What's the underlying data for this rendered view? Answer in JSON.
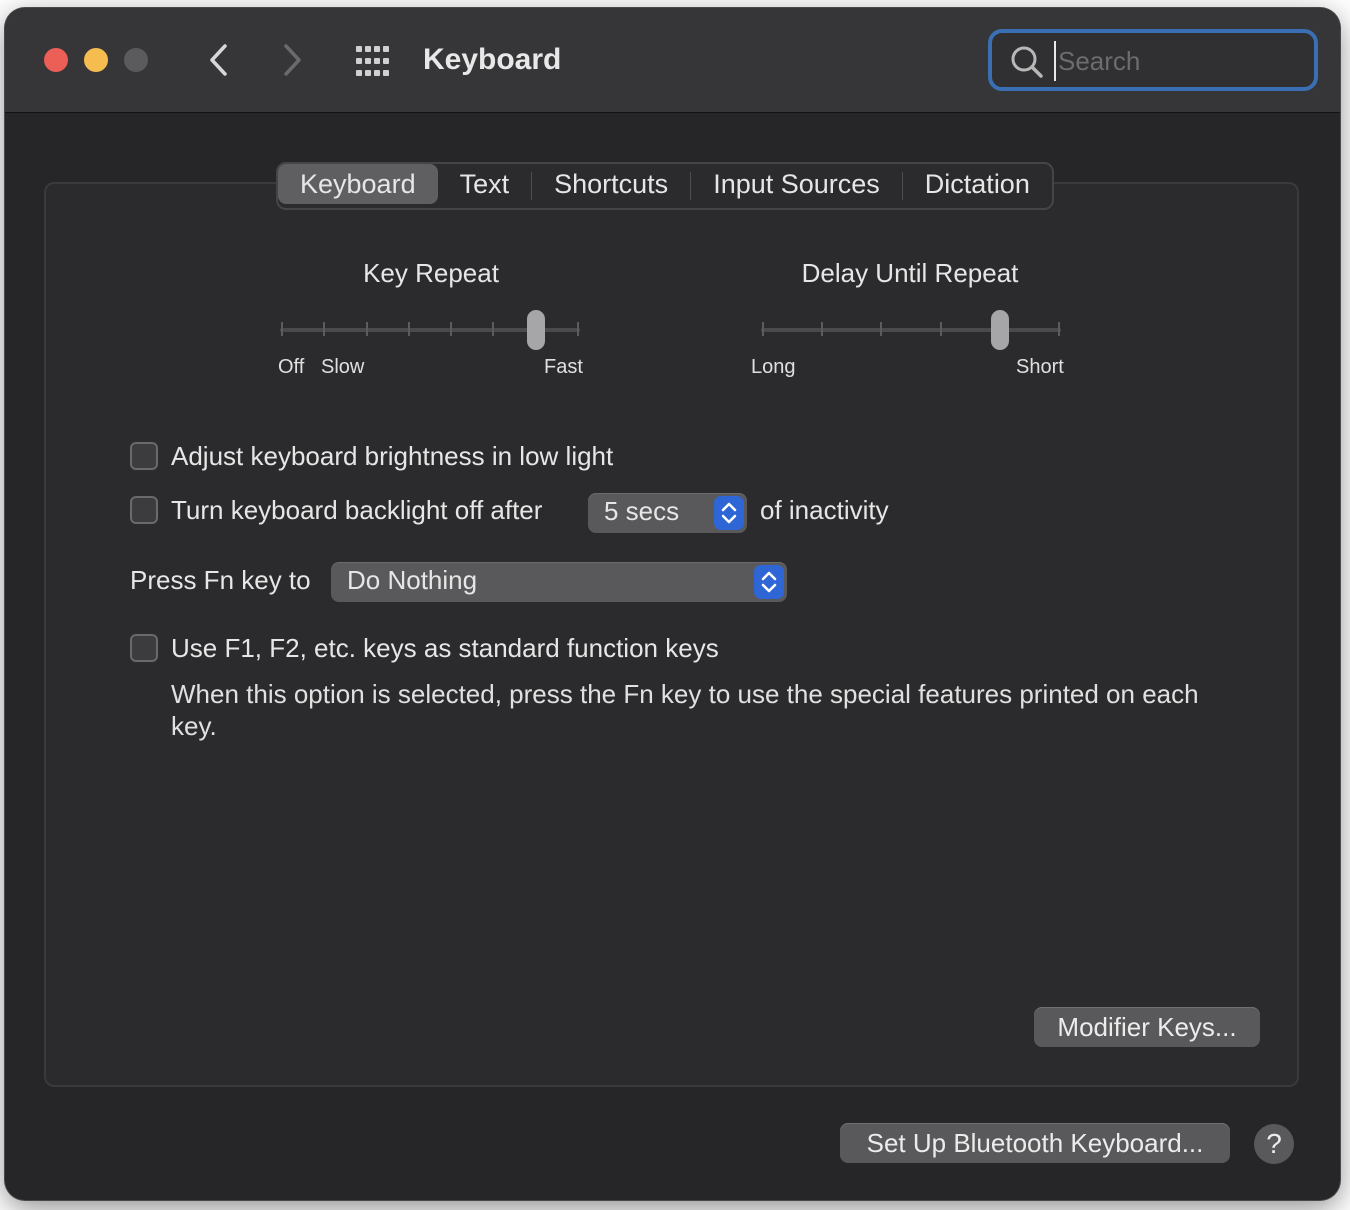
{
  "window": {
    "title": "Keyboard",
    "search_placeholder": "Search"
  },
  "tabs": [
    {
      "label": "Keyboard",
      "active": true
    },
    {
      "label": "Text",
      "active": false
    },
    {
      "label": "Shortcuts",
      "active": false
    },
    {
      "label": "Input Sources",
      "active": false
    },
    {
      "label": "Dictation",
      "active": false
    }
  ],
  "key_repeat": {
    "title": "Key Repeat",
    "labels": [
      "Off",
      "Slow",
      "Fast"
    ],
    "tick_count": 8,
    "value_index": 6
  },
  "delay_until_repeat": {
    "title": "Delay Until Repeat",
    "labels": [
      "Long",
      "Short"
    ],
    "tick_count": 6,
    "value_index": 4
  },
  "options": {
    "adjust_brightness": {
      "label": "Adjust keyboard brightness in low light",
      "checked": false
    },
    "backlight_off": {
      "label": "Turn keyboard backlight off after",
      "checked": false,
      "value": "5 secs",
      "suffix": "of inactivity"
    },
    "fn_key": {
      "label": "Press Fn key to",
      "value": "Do Nothing"
    },
    "function_keys": {
      "label": "Use F1, F2, etc. keys as standard function keys",
      "checked": false,
      "description": "When this option is selected, press the Fn key to use the special features printed on each key."
    }
  },
  "buttons": {
    "modifier_keys": "Modifier Keys...",
    "bluetooth": "Set Up Bluetooth Keyboard...",
    "help": "?"
  }
}
